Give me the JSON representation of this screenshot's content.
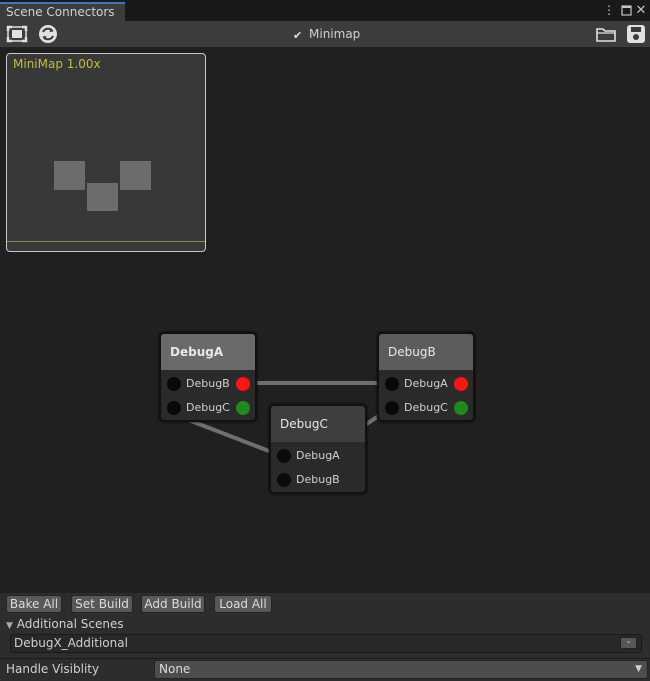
{
  "window": {
    "tab_title": "Scene Connectors",
    "menu_icon": "kebab-menu-icon",
    "maximize_icon": "maximize-icon",
    "close_icon": "close-icon"
  },
  "toolbar": {
    "frame_icon": "frame-all-icon",
    "refresh_icon": "refresh-icon",
    "minimap_label": "Minimap",
    "minimap_checked": true,
    "open_icon": "folder-icon",
    "save_icon": "save-icon"
  },
  "minimap": {
    "title": "MiniMap  1.00x"
  },
  "nodes": {
    "a": {
      "title": "DebugA",
      "ports": [
        "DebugB",
        "DebugC"
      ]
    },
    "b": {
      "title": "DebugB",
      "ports": [
        "DebugA",
        "DebugC"
      ]
    },
    "c": {
      "title": "DebugC",
      "ports": [
        "DebugA",
        "DebugB"
      ]
    }
  },
  "bottom": {
    "buttons": [
      "Bake All",
      "Set Build",
      "Add Build",
      "Load All"
    ],
    "additional_scenes_label": "Additional Scenes",
    "scene_item": "DebugX_Additional",
    "remove_label": "-",
    "handle_label": "Handle Visiblity",
    "handle_value": "None"
  },
  "colors": {
    "accent": "#3a79bb",
    "port_red": "#ff1414",
    "port_green": "#1d8c1d",
    "minimap_title": "#bfbf3a"
  }
}
